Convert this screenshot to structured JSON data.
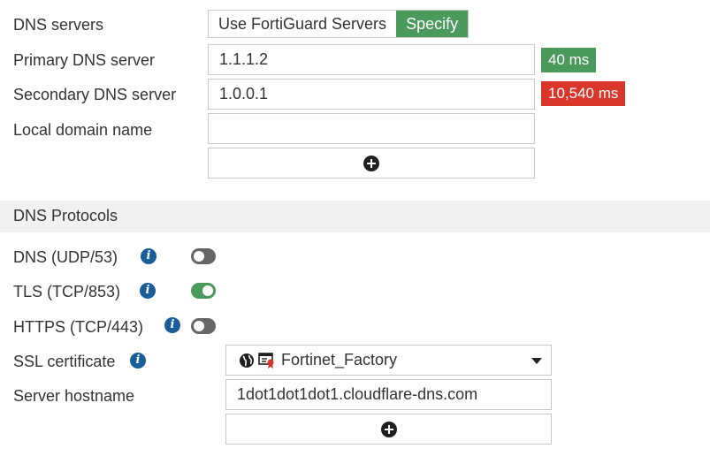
{
  "dns": {
    "servers_label": "DNS servers",
    "seg_fortiguard": "Use FortiGuard Servers",
    "seg_specify": "Specify",
    "primary_label": "Primary DNS server",
    "primary_value": "1.1.1.2",
    "primary_latency": "40 ms",
    "secondary_label": "Secondary DNS server",
    "secondary_value": "1.0.0.1",
    "secondary_latency": "10,540 ms",
    "local_domain_label": "Local domain name",
    "local_domain_value": ""
  },
  "protocols": {
    "section_title": "DNS Protocols",
    "udp_label": "DNS (UDP/53)",
    "udp_enabled": false,
    "tls_label": "TLS (TCP/853)",
    "tls_enabled": true,
    "https_label": "HTTPS (TCP/443)",
    "https_enabled": false,
    "ssl_label": "SSL certificate",
    "ssl_value": "Fortinet_Factory",
    "hostname_label": "Server hostname",
    "hostname_value": "1dot1dot1dot1.cloudflare-dns.com"
  },
  "colors": {
    "green": "#4a9a5c",
    "red": "#d9372b",
    "info_blue": "#1a5d9b"
  },
  "icons": {
    "add": "plus-circle-icon",
    "info": "info-icon",
    "globe": "globe-icon",
    "certificate": "certificate-icon",
    "dropdown": "caret-down-icon"
  }
}
